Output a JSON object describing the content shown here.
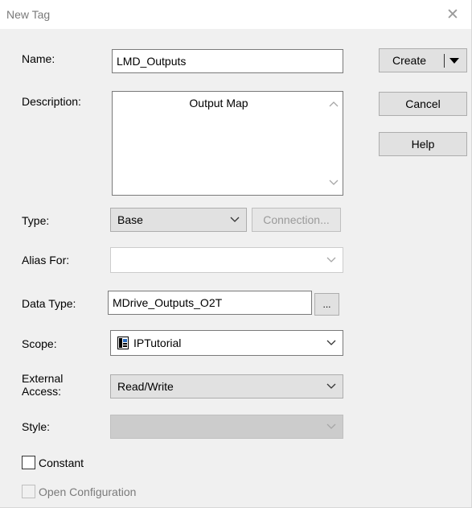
{
  "window": {
    "title": "New Tag",
    "close_glyph": "✕"
  },
  "form": {
    "name_label": "Name:",
    "name_value": "LMD_Outputs",
    "description_label": "Description:",
    "description_value": "Output Map",
    "type_label": "Type:",
    "type_value": "Base",
    "connection_button": "Connection...",
    "alias_label": "Alias For:",
    "alias_value": "",
    "data_type_label": "Data Type:",
    "data_type_value": "MDrive_Outputs_O2T",
    "browse_button": "...",
    "scope_label": "Scope:",
    "scope_value": "IPTutorial",
    "scope_icon": "controller-icon",
    "external_access_label_1": "External",
    "external_access_label_2": "Access:",
    "external_access_value": "Read/Write",
    "style_label": "Style:",
    "style_value": "",
    "constant_label": "Constant",
    "constant_checked": false,
    "open_config_label": "Open Configuration",
    "open_config_checked": false
  },
  "buttons": {
    "create": "Create",
    "cancel": "Cancel",
    "help": "Help"
  }
}
